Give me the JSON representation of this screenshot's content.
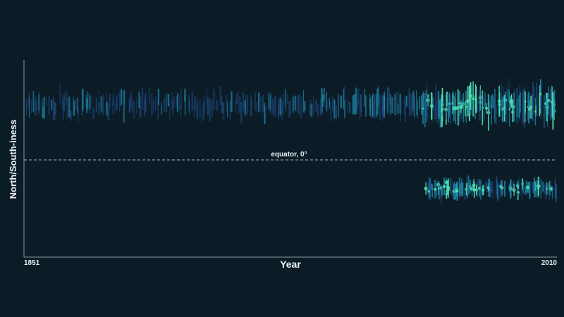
{
  "chart_data": {
    "type": "scatter",
    "title": "",
    "xlabel": "Year",
    "ylabel": "North/South-iness",
    "xlim": [
      1851,
      2010
    ],
    "x_tick_labels": [
      "1851",
      "2010"
    ],
    "annotations": [
      {
        "text": "equator, 0°",
        "y": 0
      }
    ],
    "grid": false,
    "legend": "none",
    "colors": {
      "background": "#0c1c27",
      "low_density": "#1f4f8a",
      "mid_density": "#1e8fae",
      "high_density": "#4fe0b0"
    },
    "series": [
      {
        "hemisphere": "north",
        "x_range": [
          1851,
          2010
        ],
        "band_center": 0.42,
        "band_spread": 0.28
      },
      {
        "hemisphere": "south",
        "x_range": [
          1971,
          2010
        ],
        "band_center": -0.22,
        "band_spread": 0.16
      }
    ]
  }
}
